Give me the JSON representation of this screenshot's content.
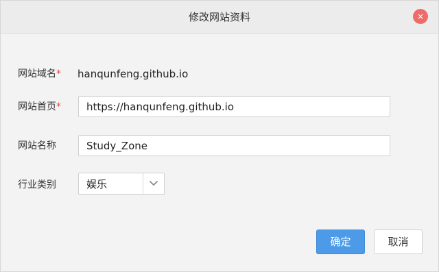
{
  "dialog": {
    "title": "修改网站资料",
    "close_glyph": "×"
  },
  "form": {
    "domain": {
      "label": "网站域名",
      "required_mark": "*",
      "value": "hanqunfeng.github.io"
    },
    "homepage": {
      "label": "网站首页",
      "required_mark": "*",
      "value": "https://hanqunfeng.github.io"
    },
    "site_name": {
      "label": "网站名称",
      "value": "Study_Zone"
    },
    "category": {
      "label": "行业类别",
      "selected": "娱乐"
    }
  },
  "buttons": {
    "confirm": "确定",
    "cancel": "取消"
  },
  "colors": {
    "primary": "#4d9be8",
    "close": "#f06a6a",
    "required": "#e04b4b"
  },
  "icons": {
    "close": "close-icon",
    "dropdown": "chevron-down-icon"
  }
}
